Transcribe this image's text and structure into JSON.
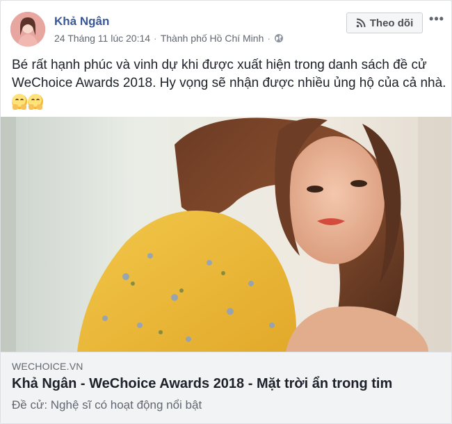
{
  "post": {
    "author": "Khả Ngân",
    "date": "24 Tháng 11 lúc 20:14",
    "separator": "·",
    "location": "Thành phố Hồ Chí Minh",
    "privacy_icon": "globe-icon",
    "follow_label": "Theo dõi",
    "follow_icon": "rss-icon",
    "more_label": "•••",
    "text_lines": [
      "Bé rất hạnh phúc và vinh dự khi được xuất hiện trong danh sách đề cử",
      "WeChoice Awards 2018. Hy vọng sẽ nhận được nhiều ủng hộ của cả nhà."
    ],
    "emojis": [
      "hugging-face-emoji",
      "hugging-face-emoji"
    ]
  },
  "link_preview": {
    "domain": "WECHOICE.VN",
    "title": "Khả Ngân - WeChoice Awards 2018 - Mặt trời ẩn trong tim",
    "description": "Đề cử: Nghệ sĩ có hoạt động nổi bật"
  },
  "colors": {
    "author_link": "#385898",
    "text": "#1d2129",
    "secondary_text": "#606770",
    "link_box_bg": "#f2f3f5"
  }
}
